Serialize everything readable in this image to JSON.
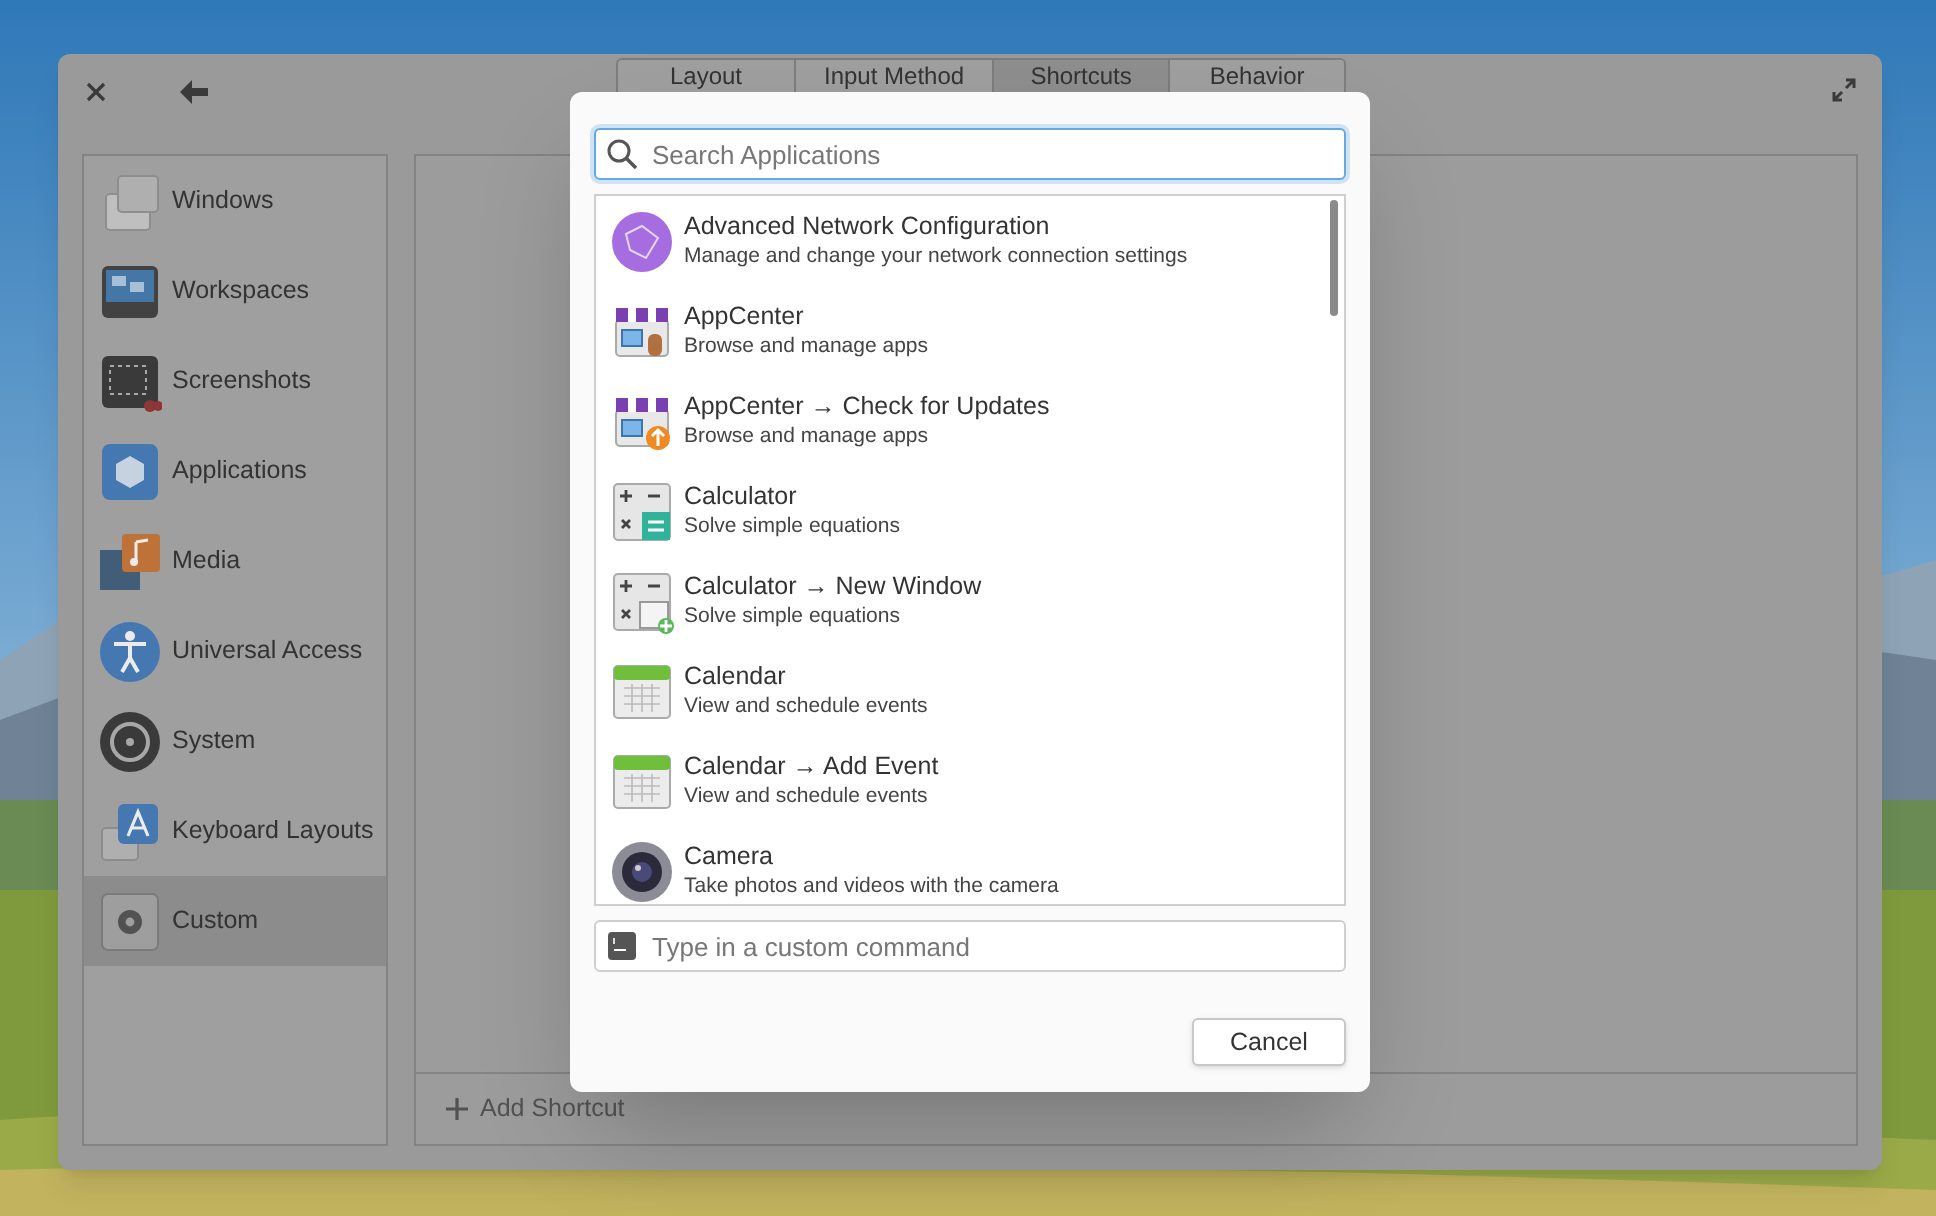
{
  "window": {
    "tabs": [
      {
        "label": "Layout",
        "selected": false
      },
      {
        "label": "Input Method",
        "selected": false
      },
      {
        "label": "Shortcuts",
        "selected": true
      },
      {
        "label": "Behavior",
        "selected": false
      }
    ],
    "sidebar": {
      "items": [
        {
          "label": "Windows",
          "selected": false
        },
        {
          "label": "Workspaces",
          "selected": false
        },
        {
          "label": "Screenshots",
          "selected": false
        },
        {
          "label": "Applications",
          "selected": false
        },
        {
          "label": "Media",
          "selected": false
        },
        {
          "label": "Universal Access",
          "selected": false
        },
        {
          "label": "System",
          "selected": false
        },
        {
          "label": "Keyboard Layouts",
          "selected": false
        },
        {
          "label": "Custom",
          "selected": true
        }
      ]
    },
    "add_shortcut": "Add Shortcut"
  },
  "dialog": {
    "search": {
      "placeholder": "Search Applications"
    },
    "apps": [
      {
        "name": "Advanced Network Configuration",
        "description": "Manage and change your network connection settings"
      },
      {
        "name": "AppCenter",
        "description": "Browse and manage apps"
      },
      {
        "name": "AppCenter → Check for Updates",
        "description": "Browse and manage apps"
      },
      {
        "name": "Calculator",
        "description": "Solve simple equations"
      },
      {
        "name": "Calculator → New Window",
        "description": "Solve simple equations"
      },
      {
        "name": "Calendar",
        "description": "View and schedule events"
      },
      {
        "name": "Calendar → Add Event",
        "description": "View and schedule events"
      },
      {
        "name": "Camera",
        "description": "Take photos and videos with the camera"
      }
    ],
    "command": {
      "placeholder": "Type in a custom command"
    },
    "cancel": "Cancel"
  }
}
